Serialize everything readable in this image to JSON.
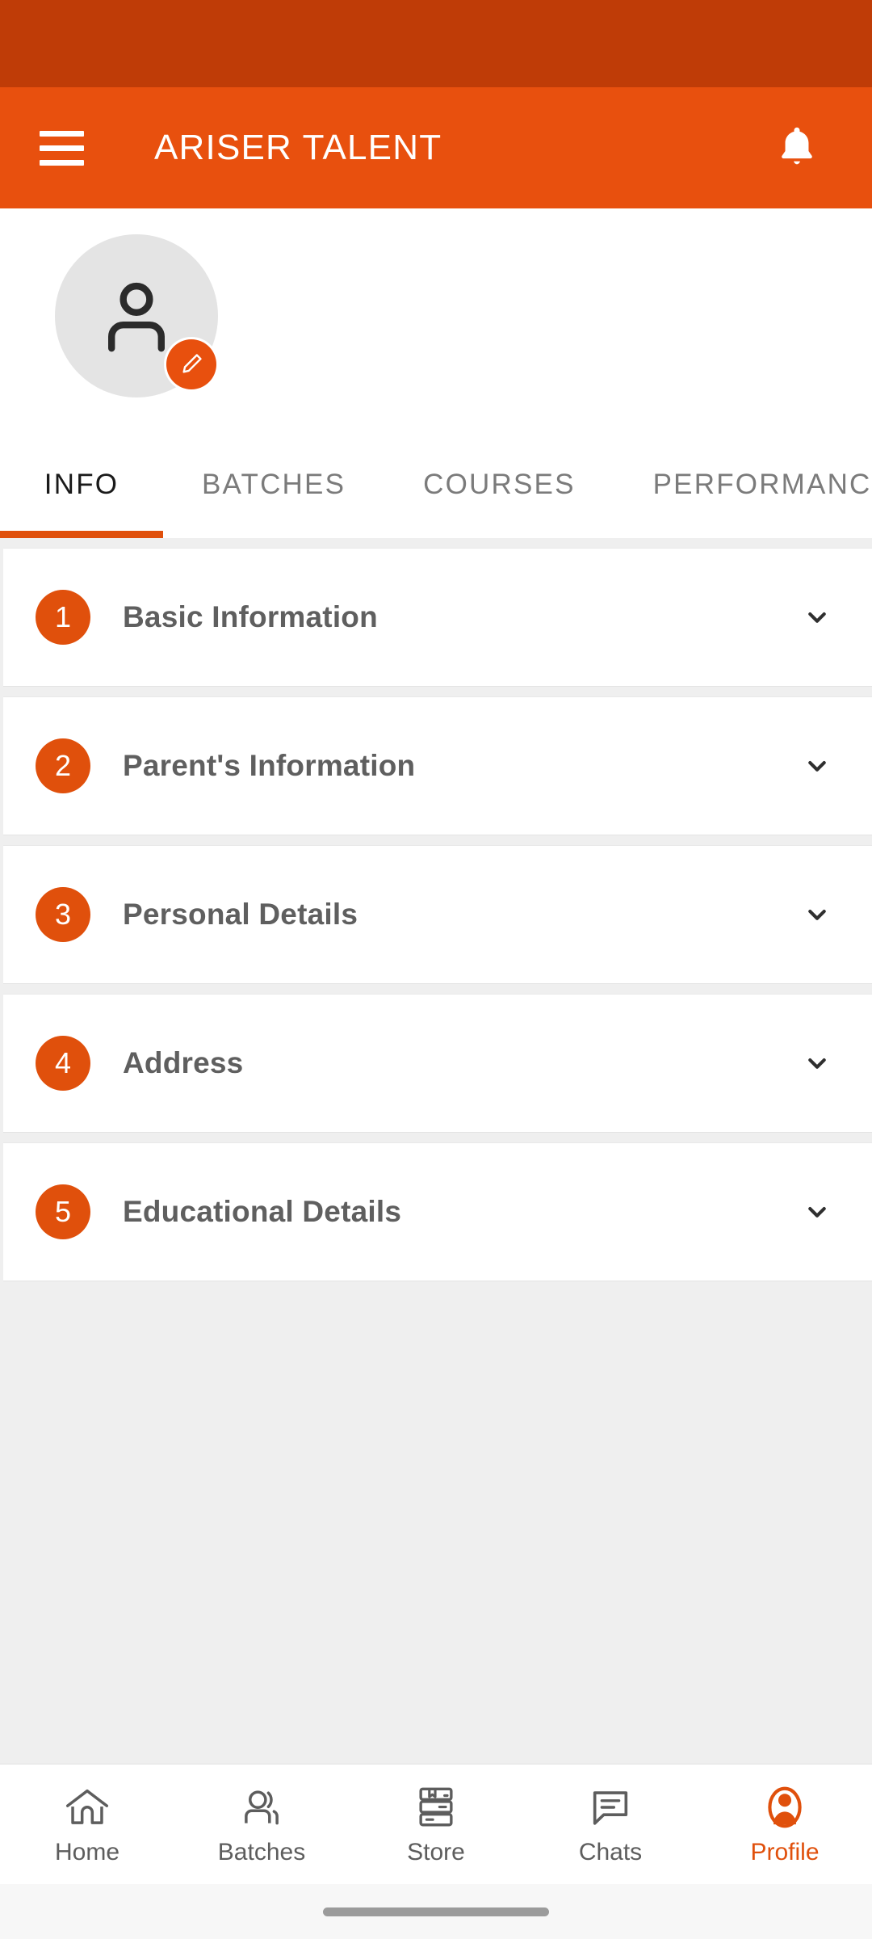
{
  "status_bar": {
    "background_color": "#BF3C07"
  },
  "app_bar": {
    "title": "ARISER TALENT",
    "background_color": "#E8500E",
    "menu_icon": "hamburger-menu-icon",
    "notification_icon": "bell-icon"
  },
  "profile": {
    "avatar_icon": "person-avatar-icon",
    "edit_badge_icon": "pencil-edit-icon",
    "accent_color": "#E8500E"
  },
  "tabs": {
    "active_index": 0,
    "indicator_color": "#E0500C",
    "items": [
      {
        "label": "INFO"
      },
      {
        "label": "BATCHES"
      },
      {
        "label": "COURSES"
      },
      {
        "label": "PERFORMANCE"
      }
    ]
  },
  "info_sections": [
    {
      "number": "1",
      "title": "Basic Information",
      "chevron": "chevron-down-icon"
    },
    {
      "number": "2",
      "title": "Parent's Information",
      "chevron": "chevron-down-icon"
    },
    {
      "number": "3",
      "title": "Personal Details",
      "chevron": "chevron-down-icon"
    },
    {
      "number": "4",
      "title": "Address",
      "chevron": "chevron-down-icon"
    },
    {
      "number": "5",
      "title": "Educational Details",
      "chevron": "chevron-down-icon"
    }
  ],
  "bottom_nav": {
    "active_index": 4,
    "active_color": "#E0500C",
    "inactive_color": "#5D5D5D",
    "items": [
      {
        "label": "Home",
        "icon": "home-icon"
      },
      {
        "label": "Batches",
        "icon": "people-group-icon"
      },
      {
        "label": "Store",
        "icon": "books-stack-icon"
      },
      {
        "label": "Chats",
        "icon": "chat-bubble-icon"
      },
      {
        "label": "Profile",
        "icon": "profile-person-icon"
      }
    ]
  }
}
